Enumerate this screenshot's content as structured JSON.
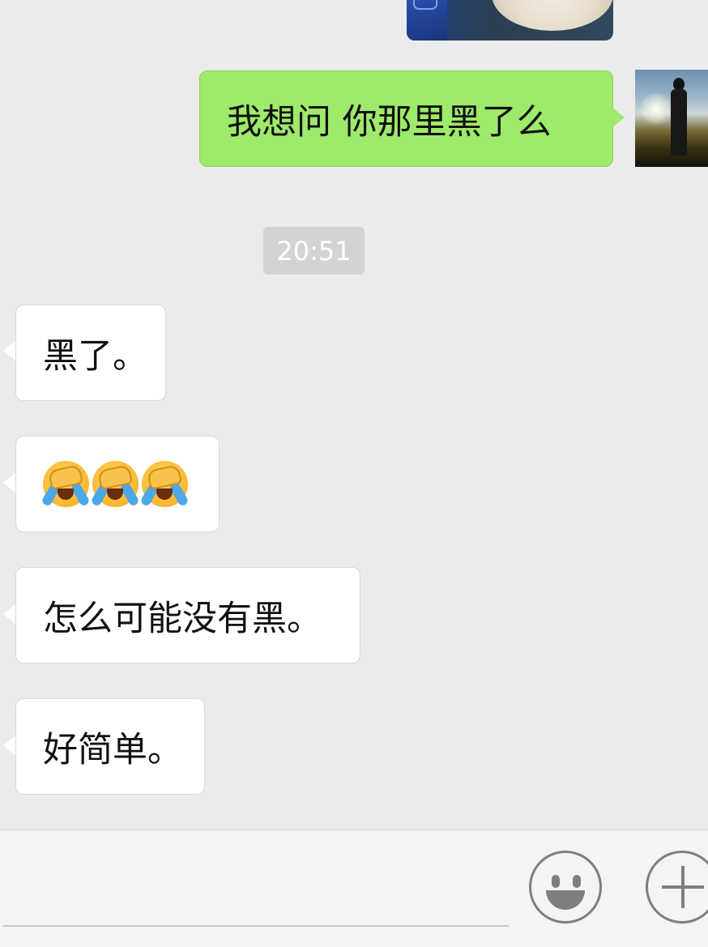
{
  "messages": {
    "outgoing": [
      {
        "type": "image",
        "description": "partial photo"
      },
      {
        "type": "text",
        "text": "我想问 你那里黑了么"
      }
    ],
    "timestamp": "20:51",
    "incoming": [
      {
        "type": "text",
        "text": "黑了。"
      },
      {
        "type": "emoji",
        "emoji_name": "facepalm-crying-emoji",
        "count": 3
      },
      {
        "type": "text",
        "text": "怎么可能没有黑。"
      },
      {
        "type": "text",
        "text": "好简单。"
      }
    ]
  },
  "input_bar": {
    "text_value": "",
    "emoji_button_icon": "smiley-face-icon",
    "more_button_icon": "plus-icon"
  },
  "colors": {
    "background": "#ebebeb",
    "outgoing_bubble": "#9eea6a",
    "incoming_bubble": "#ffffff",
    "timestamp_bg": "#d3d3d3"
  }
}
